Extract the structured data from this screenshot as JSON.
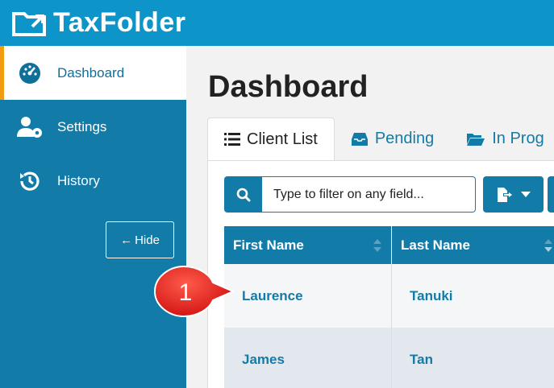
{
  "app": {
    "name": "TaxFolder",
    "accent": "#0d95c9",
    "sidebar_bg": "#137ba8",
    "active_marker": "#f39c12"
  },
  "sidebar": {
    "items": [
      {
        "label": "Dashboard",
        "icon": "dashboard-gauge-icon",
        "active": true
      },
      {
        "label": "Settings",
        "icon": "user-gear-icon",
        "active": false
      },
      {
        "label": "History",
        "icon": "history-icon",
        "active": false
      }
    ],
    "hide_label": "Hide"
  },
  "main": {
    "title": "Dashboard",
    "tabs": [
      {
        "label": "Client List",
        "icon": "list-icon",
        "active": true
      },
      {
        "label": "Pending",
        "icon": "inbox-icon",
        "active": false
      },
      {
        "label": "In Prog",
        "icon": "folder-open-icon",
        "active": false
      }
    ],
    "filter": {
      "placeholder": "Type to filter on any field...",
      "value": ""
    },
    "table": {
      "columns": [
        "First Name",
        "Last Name"
      ],
      "rows": [
        {
          "first": "Laurence",
          "last": "Tanuki"
        },
        {
          "first": "James",
          "last": "Tan"
        }
      ]
    }
  },
  "callout": {
    "number": "1",
    "color": "#e21b1b"
  }
}
